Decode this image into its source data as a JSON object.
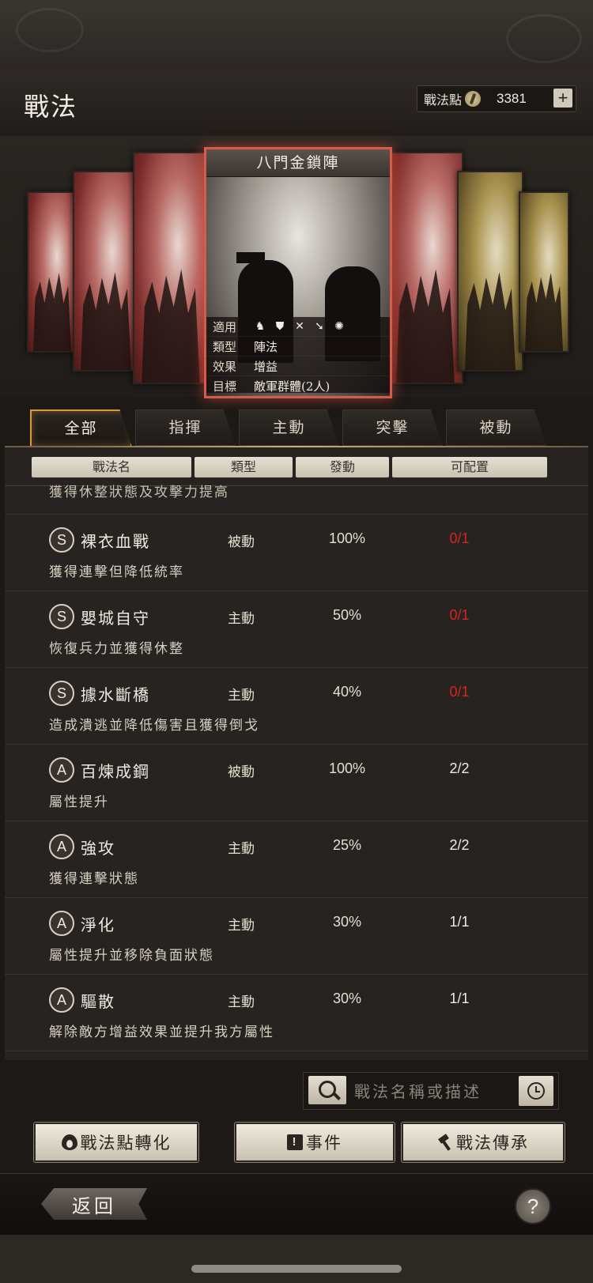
{
  "header": {
    "title": "戰法",
    "points_label": "戰法點",
    "points_value": "3381",
    "add_icon": "plus-icon"
  },
  "featured": {
    "name": "八門金鎖陣",
    "info": [
      {
        "key": "適用",
        "value": ""
      },
      {
        "key": "類型",
        "value": "陣法"
      },
      {
        "key": "效果",
        "value": "增益"
      },
      {
        "key": "目標",
        "value": "敵軍群體(2人)"
      }
    ],
    "unit_icons": [
      "cavalry-icon",
      "shield-icon",
      "crossed-weapons-icon",
      "spear-icon",
      "wheel-icon"
    ]
  },
  "tabs": [
    "全部",
    "指揮",
    "主動",
    "突擊",
    "被動"
  ],
  "active_tab": "全部",
  "columns": [
    "戰法名",
    "類型",
    "發動",
    "可配置"
  ],
  "partial_row": "獲得休整狀態及攻擊力提高",
  "tactics": [
    {
      "grade": "S",
      "name": "裸衣血戰",
      "type": "被動",
      "rate": "100%",
      "available": "0/1",
      "available_color": "#d7261f",
      "desc": "獲得連擊但降低統率"
    },
    {
      "grade": "S",
      "name": "嬰城自守",
      "type": "主動",
      "rate": "50%",
      "available": "0/1",
      "available_color": "#d7261f",
      "desc": "恢復兵力並獲得休整"
    },
    {
      "grade": "S",
      "name": "據水斷橋",
      "type": "主動",
      "rate": "40%",
      "available": "0/1",
      "available_color": "#d7261f",
      "desc": "造成潰逃並降低傷害且獲得倒戈"
    },
    {
      "grade": "A",
      "name": "百煉成鋼",
      "type": "被動",
      "rate": "100%",
      "available": "2/2",
      "available_color": "#f0ebe0",
      "desc": "屬性提升"
    },
    {
      "grade": "A",
      "name": "強攻",
      "type": "主動",
      "rate": "25%",
      "available": "2/2",
      "available_color": "#f0ebe0",
      "desc": "獲得連擊狀態"
    },
    {
      "grade": "A",
      "name": "淨化",
      "type": "主動",
      "rate": "30%",
      "available": "1/1",
      "available_color": "#f0ebe0",
      "desc": "屬性提升並移除負面狀態"
    },
    {
      "grade": "A",
      "name": "驅散",
      "type": "主動",
      "rate": "30%",
      "available": "1/1",
      "available_color": "#f0ebe0",
      "desc": "解除敵方增益效果並提升我方屬性"
    }
  ],
  "search": {
    "placeholder": "戰法名稱或描述"
  },
  "actions": {
    "convert": "戰法點轉化",
    "events": "事件",
    "inherit": "戰法傳承"
  },
  "back_label": "返回",
  "help_label": "?"
}
